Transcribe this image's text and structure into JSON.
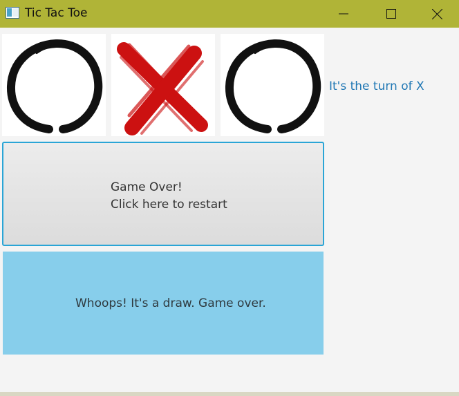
{
  "window": {
    "title": "Tic Tac Toe",
    "titlebar_color": "#b0b437",
    "controls": [
      "minimize-icon",
      "maximize-icon",
      "close-icon"
    ]
  },
  "board": {
    "cells": [
      "O",
      "X",
      "O"
    ],
    "o_mark_color": "#111111",
    "x_mark_color": "#cc1111"
  },
  "turn": {
    "label": "It's the turn of X",
    "color": "#1f77b4"
  },
  "restart_button": {
    "line1": "Game Over!",
    "line2": "Click here to restart",
    "border_color": "#2aa5d6"
  },
  "status": {
    "message": "Whoops! It's a draw. Game over.",
    "background": "#87ceeb"
  }
}
